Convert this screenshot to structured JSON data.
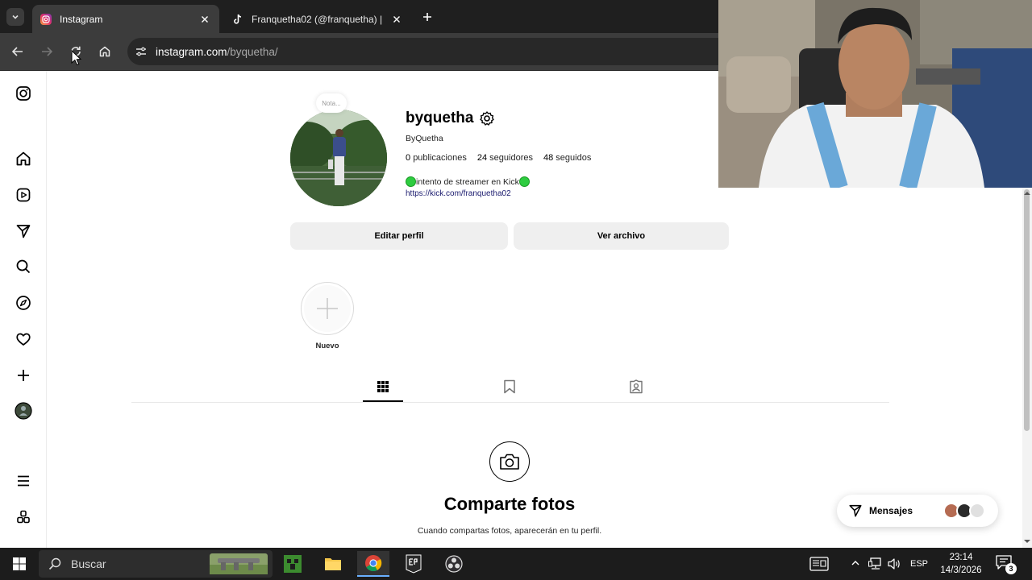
{
  "browser": {
    "tabs": [
      {
        "title": "Instagram",
        "active": true
      },
      {
        "title": "Franquetha02 (@franquetha) |",
        "active": false
      }
    ],
    "url_host": "instagram.com",
    "url_path": "/byquetha/"
  },
  "profile": {
    "note_label": "Nota...",
    "username": "byquetha",
    "full_name": "ByQuetha",
    "posts": "0",
    "posts_label": "publicaciones",
    "followers": "24",
    "followers_label": "seguidores",
    "following": "48",
    "following_label": "seguidos",
    "bio": "intento de streamer en Kick",
    "bio_link": "https://kick.com/franquetha02",
    "edit_button": "Editar perfil",
    "archive_button": "Ver archivo",
    "highlight_new": "Nuevo"
  },
  "empty_state": {
    "title": "Comparte fotos",
    "subtitle": "Cuando compartas fotos, aparecerán en tu perfil."
  },
  "messages": {
    "label": "Mensajes"
  },
  "taskbar": {
    "search_placeholder": "Buscar",
    "language": "ESP",
    "time": "23:14",
    "date": "14/3/2026",
    "notifications": "3"
  },
  "colors": {
    "bio_dot": "#2ecc40",
    "chrome_dark": "#1f1f1f",
    "accent_blue": "#6ab0ff"
  }
}
